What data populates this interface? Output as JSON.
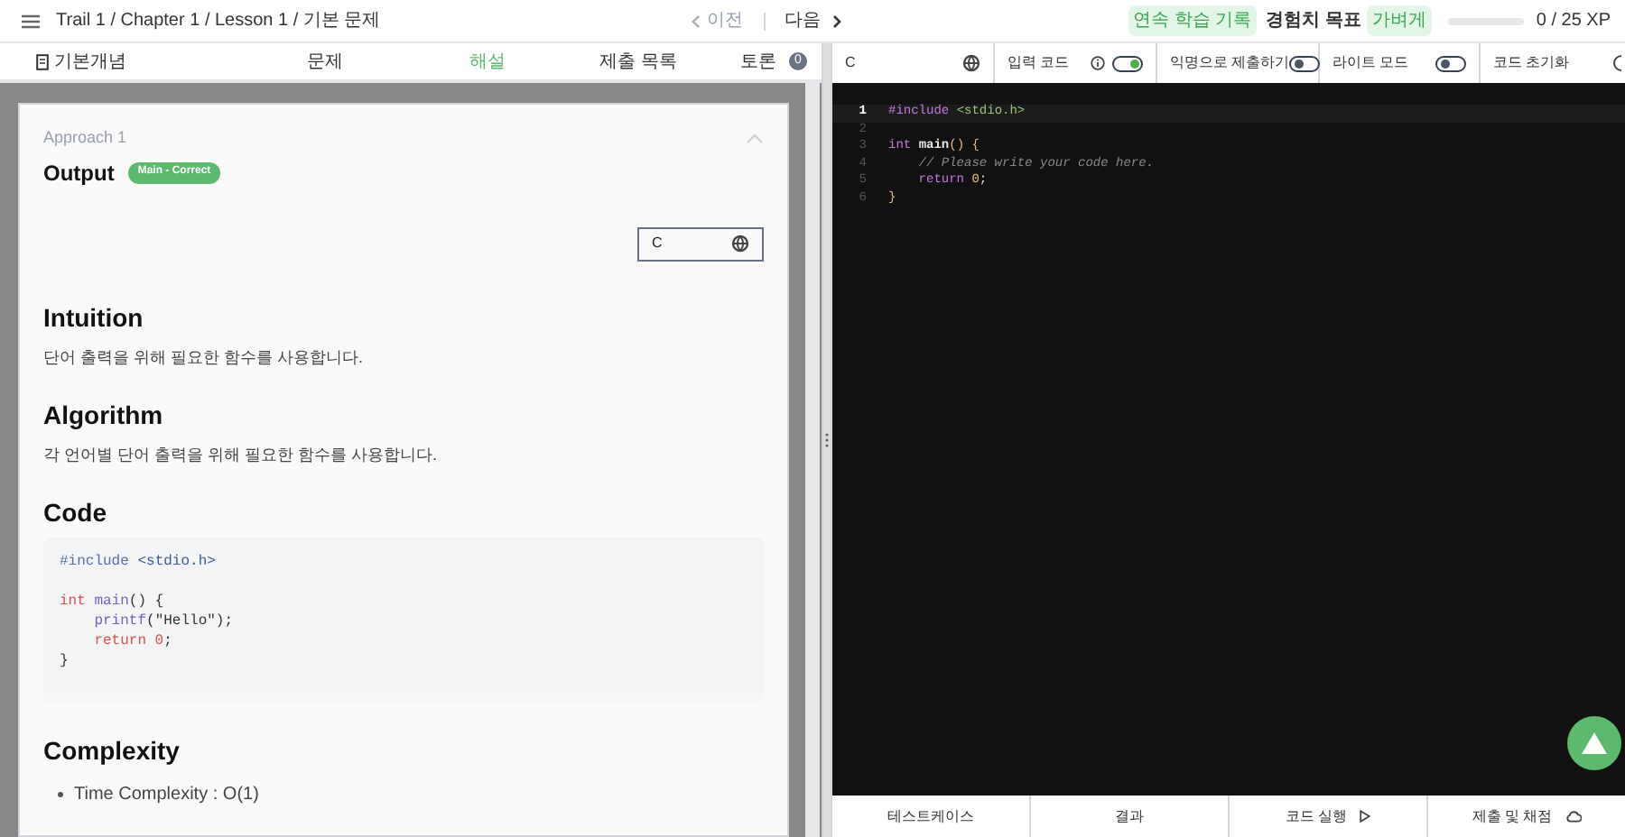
{
  "header": {
    "breadcrumb": "Trail 1 / Chapter 1 / Lesson 1 / 기본 문제",
    "prev": "이전",
    "next": "다음",
    "streak_badge": "연속 학습 기록",
    "xp_label": "경험치 목표",
    "xp_badge": "가벼게",
    "xp": {
      "level": 0,
      "reading": "0 / 25 XP"
    }
  },
  "tabs": [
    {
      "label": "기본개념",
      "kind": "book",
      "selected": false
    },
    {
      "label": "문제",
      "kind": "plain",
      "selected": false
    },
    {
      "label": "해설",
      "kind": "plain",
      "selected": true
    },
    {
      "label": "제출 목록",
      "kind": "plain",
      "selected": false
    },
    {
      "label": "토론",
      "kind": "count",
      "count": "0",
      "selected": false
    }
  ],
  "solution": {
    "approach": "Approach 1",
    "expanded": true,
    "output_title": "Output",
    "output_badge": "Main - Correct",
    "language": "C",
    "sections": [
      {
        "kind": "text",
        "heading": "Intuition",
        "body": "단어 출력을 위해 필요한 함수를 사용합니다."
      },
      {
        "kind": "text",
        "heading": "Algorithm",
        "body": "각 언어별 단어 출력을 위해 필요한 함수를 사용합니다."
      },
      {
        "kind": "code",
        "heading": "Code",
        "lines": [
          {
            "kind": "code",
            "indented": false,
            "tokens": [
              {
                "text": "#include",
                "kind": "preprocessor"
              },
              {
                "text": "<stdio.h>",
                "kind": "header"
              }
            ]
          },
          {
            "kind": "blank"
          },
          {
            "kind": "code",
            "indented": false,
            "tokens": [
              {
                "text": "int",
                "kind": "keyword"
              },
              {
                "text": "main",
                "kind": "function"
              },
              {
                "text": "() {",
                "kind": "punctuation"
              }
            ]
          },
          {
            "kind": "code",
            "indented": true,
            "tokens": [
              {
                "text": "printf",
                "kind": "function"
              },
              {
                "text": "(\"Hello\");",
                "kind": "punctuation"
              }
            ]
          },
          {
            "kind": "code",
            "indented": true,
            "tokens": [
              {
                "text": "return 0",
                "kind": "keyword"
              },
              {
                "text": ";",
                "kind": "punctuation"
              }
            ]
          },
          {
            "kind": "code",
            "indented": false,
            "tokens": [
              {
                "text": "}",
                "kind": "punctuation"
              }
            ]
          }
        ]
      },
      {
        "kind": "list",
        "heading": "Complexity",
        "items": [
          "Time Complexity : O(1)"
        ]
      }
    ]
  },
  "editor_toolbar": [
    {
      "kind": "language",
      "label": "C"
    },
    {
      "kind": "toggle",
      "label": "입력 코드",
      "info": true,
      "on": true
    },
    {
      "kind": "toggle",
      "label": "익명으로 제출하기",
      "info": false,
      "on": false
    },
    {
      "kind": "toggle",
      "label": "라이트 모드",
      "info": false,
      "on": false
    },
    {
      "kind": "action",
      "label": "코드 초기화"
    }
  ],
  "editor": {
    "lines": [
      {
        "number": "1",
        "selected": true,
        "indented": false,
        "tokens": [
          {
            "text": "#include",
            "kind": "preprocessor"
          },
          {
            "text": "<stdio.h>",
            "kind": "header"
          }
        ]
      },
      {
        "number": "2",
        "selected": false
      },
      {
        "number": "3",
        "selected": false,
        "indented": false,
        "tokens": [
          {
            "text": "int",
            "kind": "keyword"
          },
          {
            "text": "main",
            "kind": "function"
          },
          {
            "text": "() {",
            "kind": "bracket"
          }
        ]
      },
      {
        "number": "4",
        "selected": false,
        "indented": true,
        "tokens": [
          {
            "text": "// Please write your code here.",
            "kind": "comment"
          }
        ]
      },
      {
        "number": "5",
        "selected": false,
        "indented": true,
        "tokens": [
          {
            "text": "return",
            "kind": "keyword"
          },
          {
            "text": "0",
            "kind": "number"
          },
          {
            "text": ";",
            "kind": "punctuation"
          }
        ]
      },
      {
        "number": "6",
        "selected": false,
        "indented": false,
        "tokens": [
          {
            "text": "}",
            "kind": "bracket"
          }
        ]
      }
    ]
  },
  "bottom_buttons": [
    {
      "label": "테스트케이스",
      "kind": "plain"
    },
    {
      "label": "결과",
      "kind": "plain"
    },
    {
      "label": "코드 실행",
      "kind": "run"
    },
    {
      "label": "제출 및 채점",
      "kind": "submit"
    }
  ]
}
